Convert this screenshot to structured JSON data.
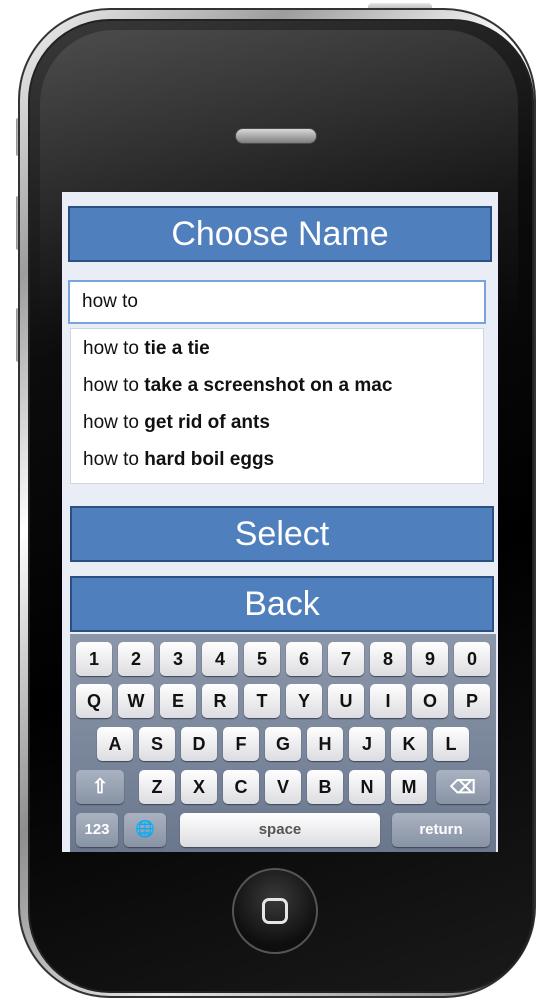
{
  "screen": {
    "title": "Choose Name",
    "search": {
      "value": "how to"
    },
    "suggestions": [
      {
        "prefix": "how to ",
        "completion": "tie a tie"
      },
      {
        "prefix": "how to ",
        "completion": "take a screenshot on a mac"
      },
      {
        "prefix": "how to ",
        "completion": "get rid of ants"
      },
      {
        "prefix": "how to ",
        "completion": "hard boil eggs"
      }
    ],
    "select_label": "Select",
    "back_label": "Back"
  },
  "keyboard": {
    "row1": [
      "1",
      "2",
      "3",
      "4",
      "5",
      "6",
      "7",
      "8",
      "9",
      "0"
    ],
    "row2": [
      "Q",
      "W",
      "E",
      "R",
      "T",
      "Y",
      "U",
      "I",
      "O",
      "P"
    ],
    "row3": [
      "A",
      "S",
      "D",
      "F",
      "G",
      "H",
      "J",
      "K",
      "L"
    ],
    "row4": [
      "Z",
      "X",
      "C",
      "V",
      "B",
      "N",
      "M"
    ],
    "numbers_key": "123",
    "space_key": "space",
    "return_key": "return",
    "shift_glyph": "⇧",
    "delete_glyph": "⌫",
    "globe_glyph": "🌐"
  },
  "colors": {
    "accent": "#4f7fbd",
    "accent_border": "#2b4f80",
    "search_border": "#7aa2e0"
  },
  "icons": [
    "speaker-grille",
    "home-button-icon",
    "shift-icon",
    "delete-icon",
    "globe-icon"
  ]
}
